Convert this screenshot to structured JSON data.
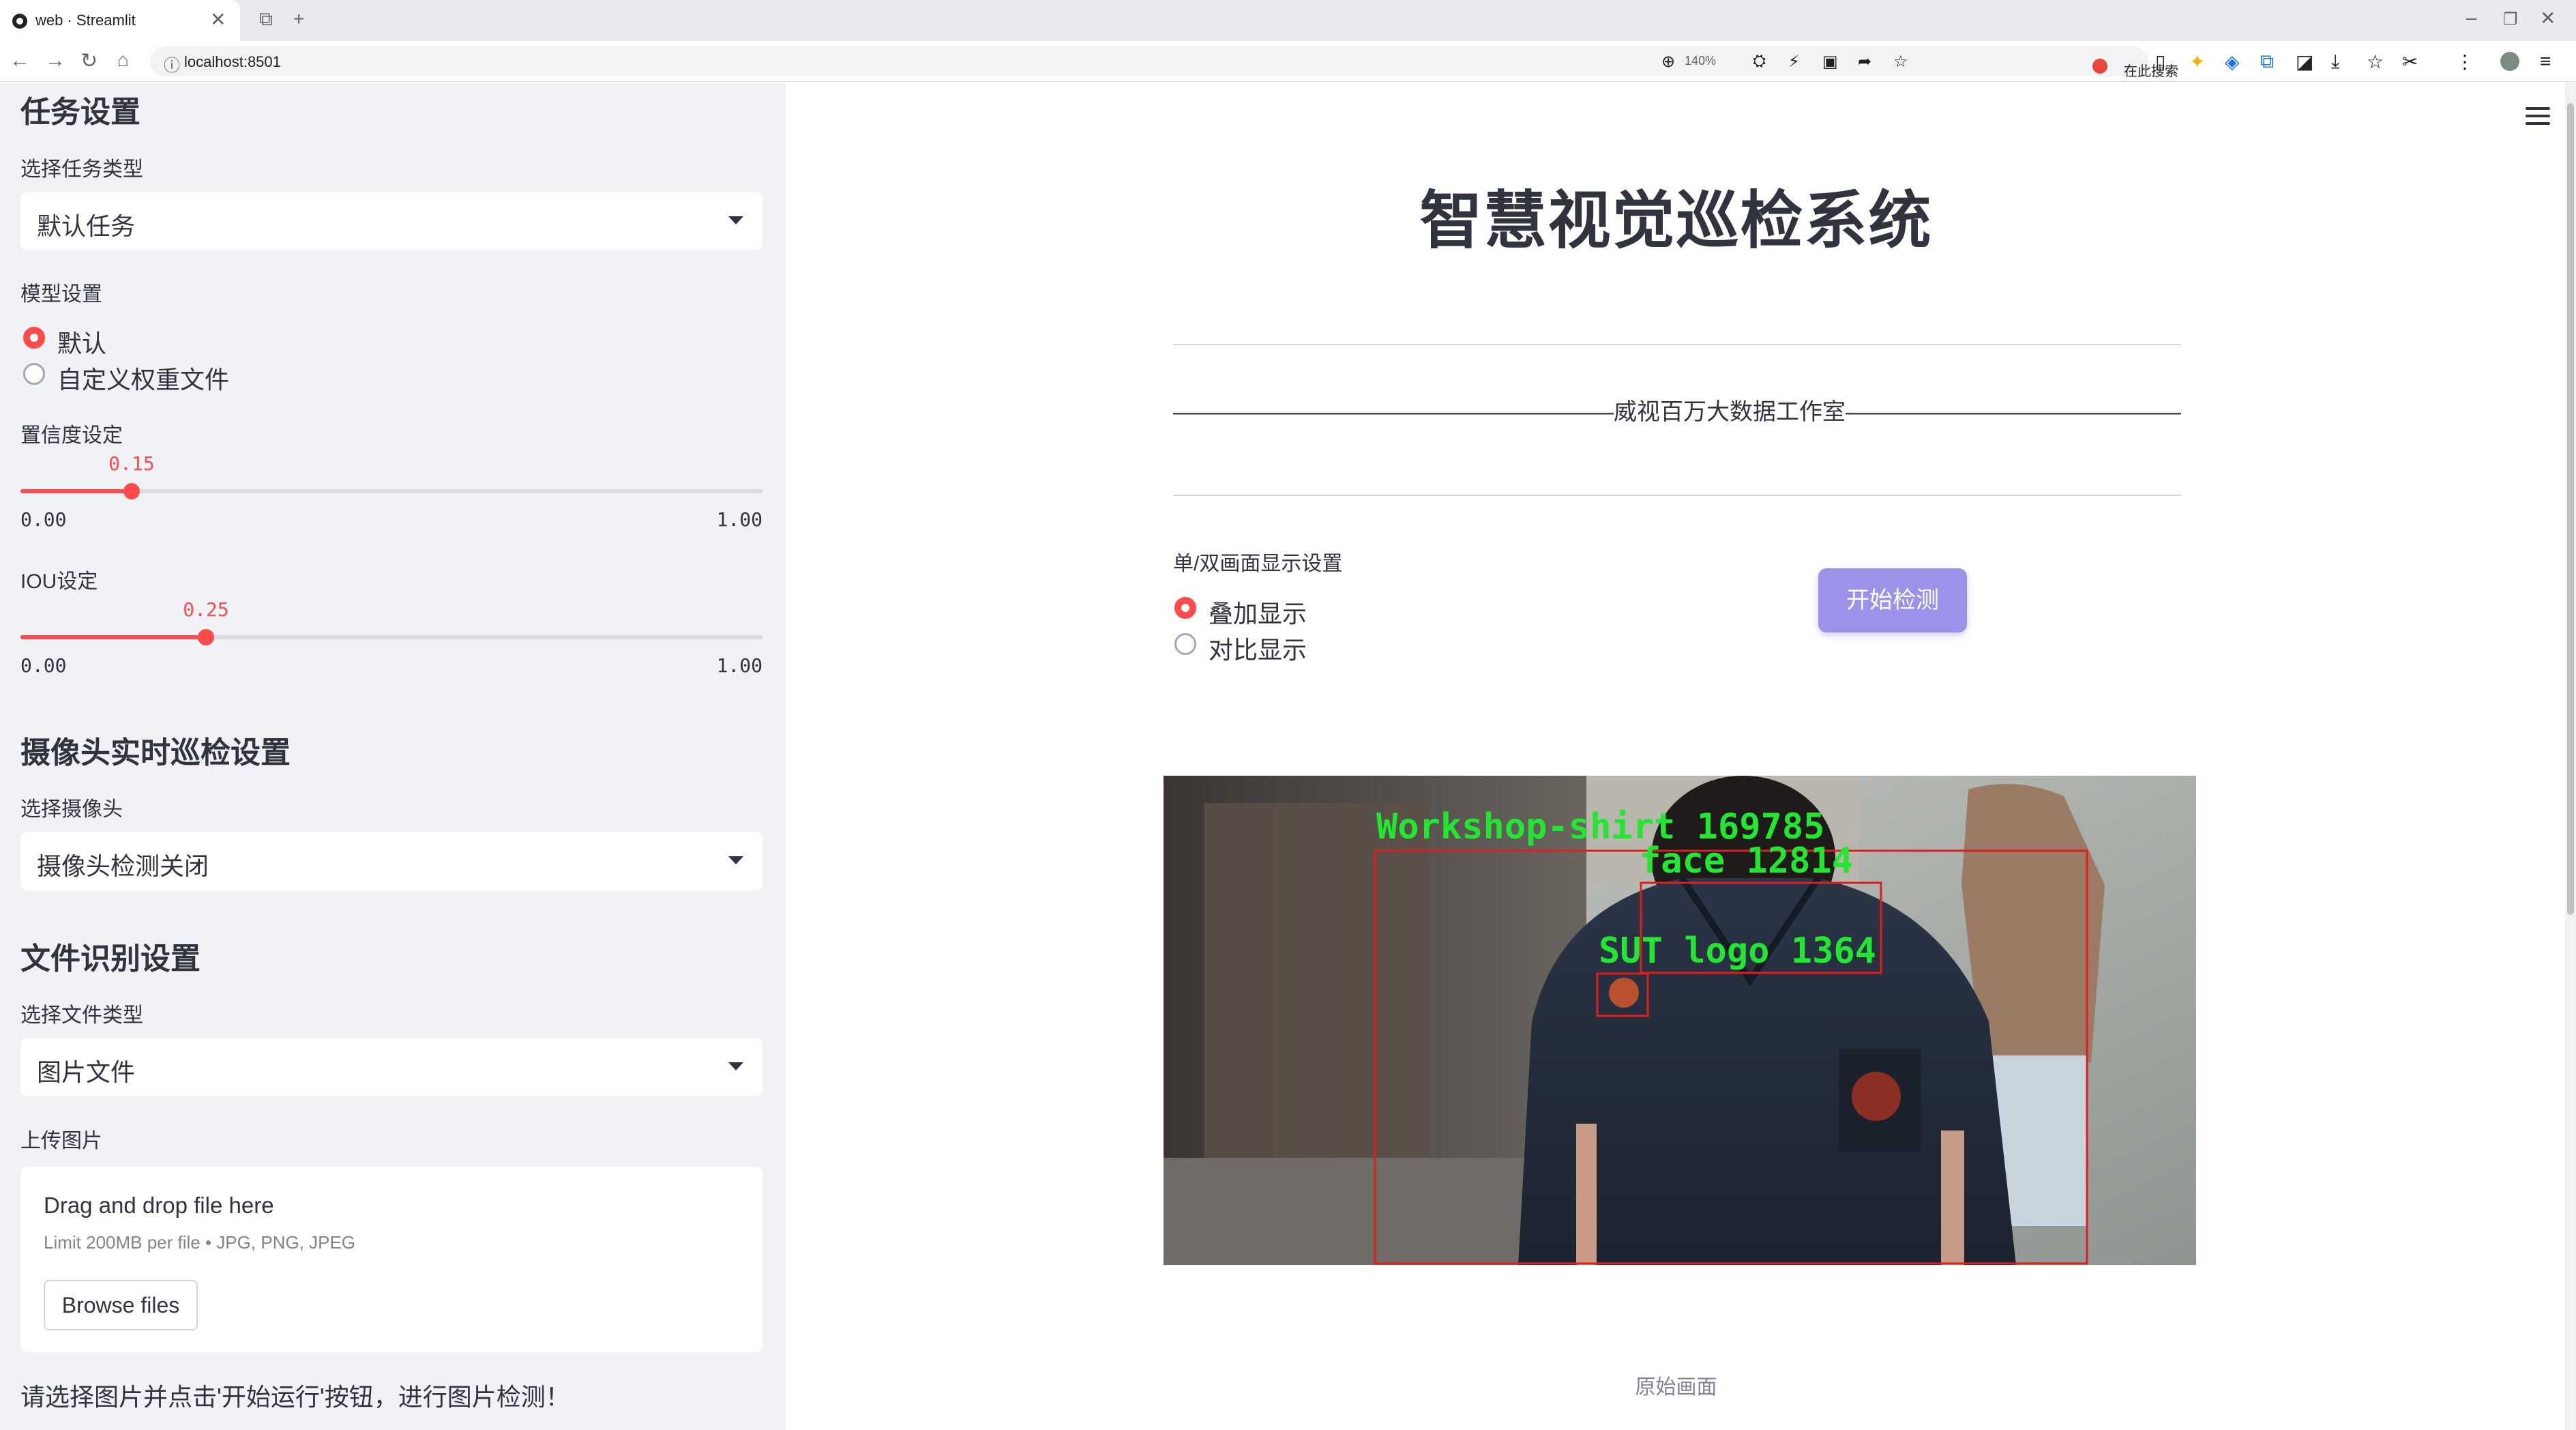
{
  "browser": {
    "tab_title": "web · Streamlit",
    "url": "localhost:8501",
    "zoom": "140%",
    "search_label": "在此搜索",
    "icons": [
      "back-icon",
      "forward-icon",
      "reload-icon",
      "home-icon",
      "info-icon",
      "zoom-icon"
    ]
  },
  "sidebar": {
    "task_section_title": "任务设置",
    "task_type_label": "选择任务类型",
    "task_type_value": "默认任务",
    "model_label": "模型设置",
    "model_options": [
      "默认",
      "自定义权重文件"
    ],
    "model_selected": "默认",
    "confidence_label": "置信度设定",
    "confidence": {
      "value": 0.15,
      "value_text": "0.15",
      "min": "0.00",
      "max": "1.00"
    },
    "iou_label": "IOU设定",
    "iou": {
      "value": 0.25,
      "value_text": "0.25",
      "min": "0.00",
      "max": "1.00"
    },
    "camera_section_title": "摄像头实时巡检设置",
    "camera_label": "选择摄像头",
    "camera_value": "摄像头检测关闭",
    "file_section_title": "文件识别设置",
    "file_type_label": "选择文件类型",
    "file_type_value": "图片文件",
    "upload_label": "上传图片",
    "uploader": {
      "title": "Drag and drop file here",
      "subtitle": "Limit 200MB per file • JPG, PNG, JPEG",
      "button": "Browse files"
    },
    "note": "请选择图片并点击'开始运行'按钮，进行图片检测！"
  },
  "main": {
    "title": "智慧视觉巡检系统",
    "subtitle": "———————————————————威视百万大数据工作室————————————————————",
    "display_mode_label": "单/双画面显示设置",
    "display_modes": [
      "叠加显示",
      "对比显示"
    ],
    "display_selected": "叠加显示",
    "start_button": "开始检测",
    "image_caption": "原始画面",
    "detections": [
      {
        "label": "Workshop-shirt 169785"
      },
      {
        "label": "face 12814"
      },
      {
        "label": "SUT logo 1364"
      }
    ],
    "colors": {
      "accent": "#ff4b4b",
      "button": "#9b93ea",
      "box": "#e11d1d",
      "label": "#22e632"
    }
  }
}
